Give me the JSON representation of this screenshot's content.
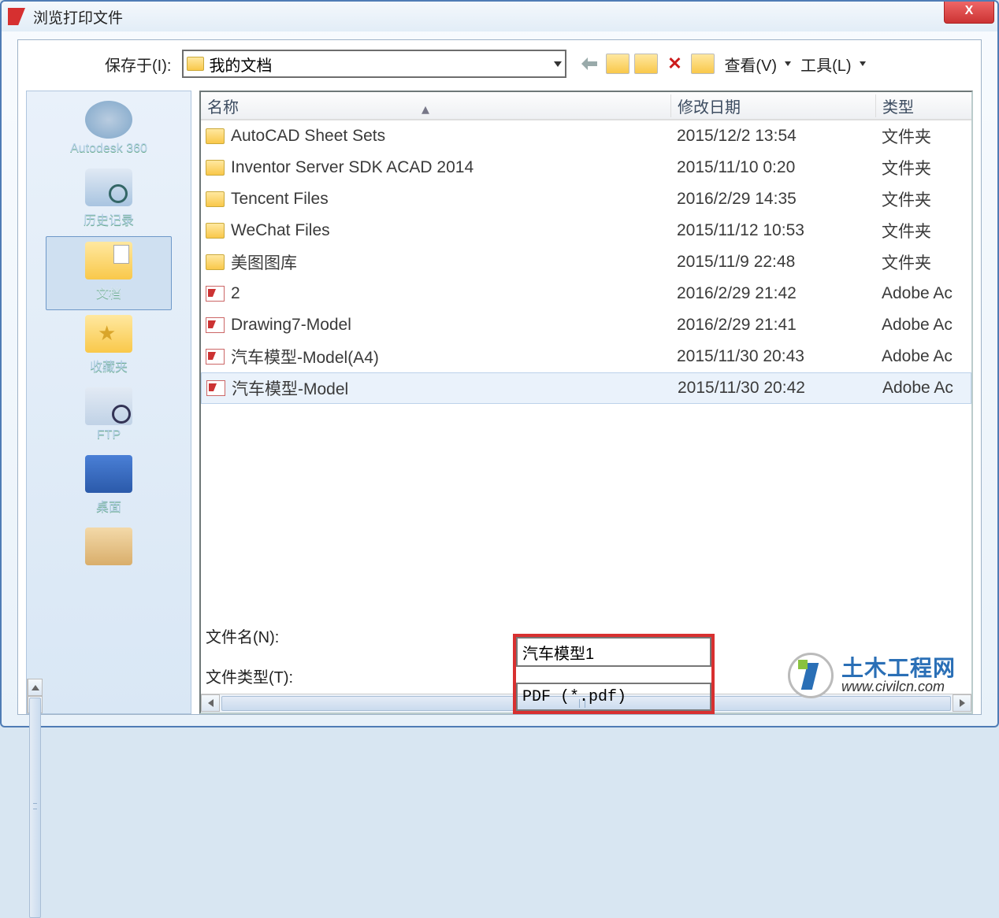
{
  "title": "浏览打印文件",
  "savein_label": "保存于(I):",
  "location": "我的文档",
  "toolbar": {
    "view": "查看(V)",
    "tools": "工具(L)"
  },
  "columns": {
    "name": "名称",
    "date": "修改日期",
    "type": "类型"
  },
  "sidebar": {
    "items": [
      {
        "label": "Autodesk 360"
      },
      {
        "label": "历史记录"
      },
      {
        "label": "文档"
      },
      {
        "label": "收藏夹"
      },
      {
        "label": "FTP"
      },
      {
        "label": "桌面"
      }
    ]
  },
  "files": [
    {
      "name": "AutoCAD Sheet Sets",
      "date": "2015/12/2 13:54",
      "type": "文件夹",
      "icon": "folder"
    },
    {
      "name": "Inventor Server SDK ACAD 2014",
      "date": "2015/11/10 0:20",
      "type": "文件夹",
      "icon": "folder"
    },
    {
      "name": "Tencent Files",
      "date": "2016/2/29 14:35",
      "type": "文件夹",
      "icon": "folder"
    },
    {
      "name": "WeChat Files",
      "date": "2015/11/12 10:53",
      "type": "文件夹",
      "icon": "folder"
    },
    {
      "name": "美图图库",
      "date": "2015/11/9 22:48",
      "type": "文件夹",
      "icon": "folder"
    },
    {
      "name": "2",
      "date": "2016/2/29 21:42",
      "type": "Adobe Ac",
      "icon": "pdf"
    },
    {
      "name": "Drawing7-Model",
      "date": "2016/2/29 21:41",
      "type": "Adobe Ac",
      "icon": "pdf"
    },
    {
      "name": "汽车模型-Model(A4)",
      "date": "2015/11/30 20:43",
      "type": "Adobe Ac",
      "icon": "pdf"
    },
    {
      "name": "汽车模型-Model",
      "date": "2015/11/30 20:42",
      "type": "Adobe Ac",
      "icon": "pdf"
    }
  ],
  "filename_label": "文件名(N):",
  "filetype_label": "文件类型(T):",
  "filename_value": "汽车模型1",
  "filetype_value": "PDF (*.pdf)",
  "watermark": {
    "cn": "土木工程网",
    "url": "www.civilcn.com"
  }
}
